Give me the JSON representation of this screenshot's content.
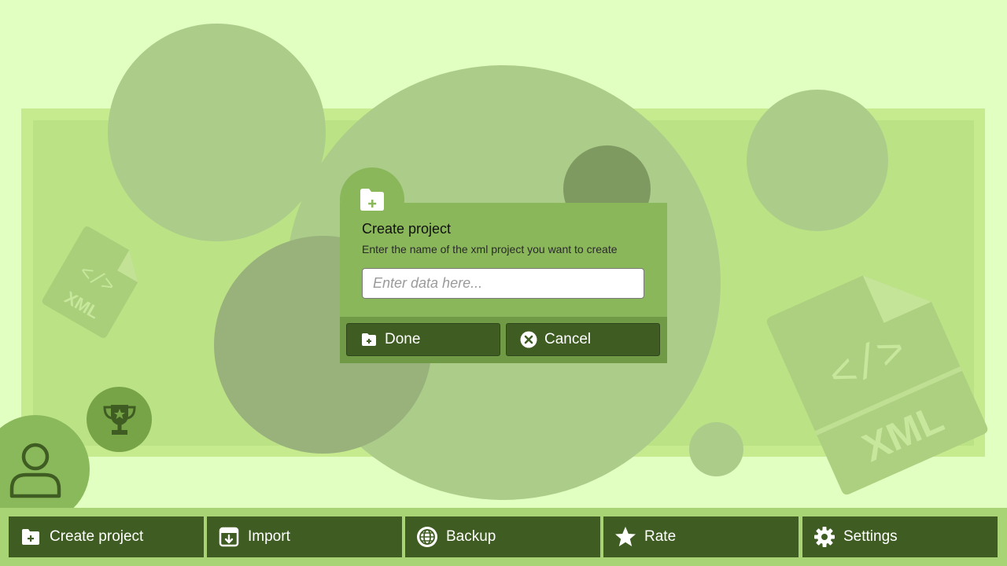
{
  "dialog": {
    "title": "Create project",
    "subtitle": "Enter the name of the xml project you want to create",
    "input_placeholder": "Enter data here...",
    "done_label": "Done",
    "cancel_label": "Cancel"
  },
  "decor": {
    "xml_icon_label": "XML"
  },
  "bottom_nav": [
    {
      "label": "Create project",
      "icon": "folder-plus-icon"
    },
    {
      "label": "Import",
      "icon": "import-icon"
    },
    {
      "label": "Backup",
      "icon": "globe-icon"
    },
    {
      "label": "Rate",
      "icon": "star-icon"
    },
    {
      "label": "Settings",
      "icon": "gear-icon"
    }
  ],
  "colors": {
    "background": "#e0ffc0",
    "panel": "#bce286",
    "accent": "#89b759",
    "button_dark": "#3f5d22"
  }
}
